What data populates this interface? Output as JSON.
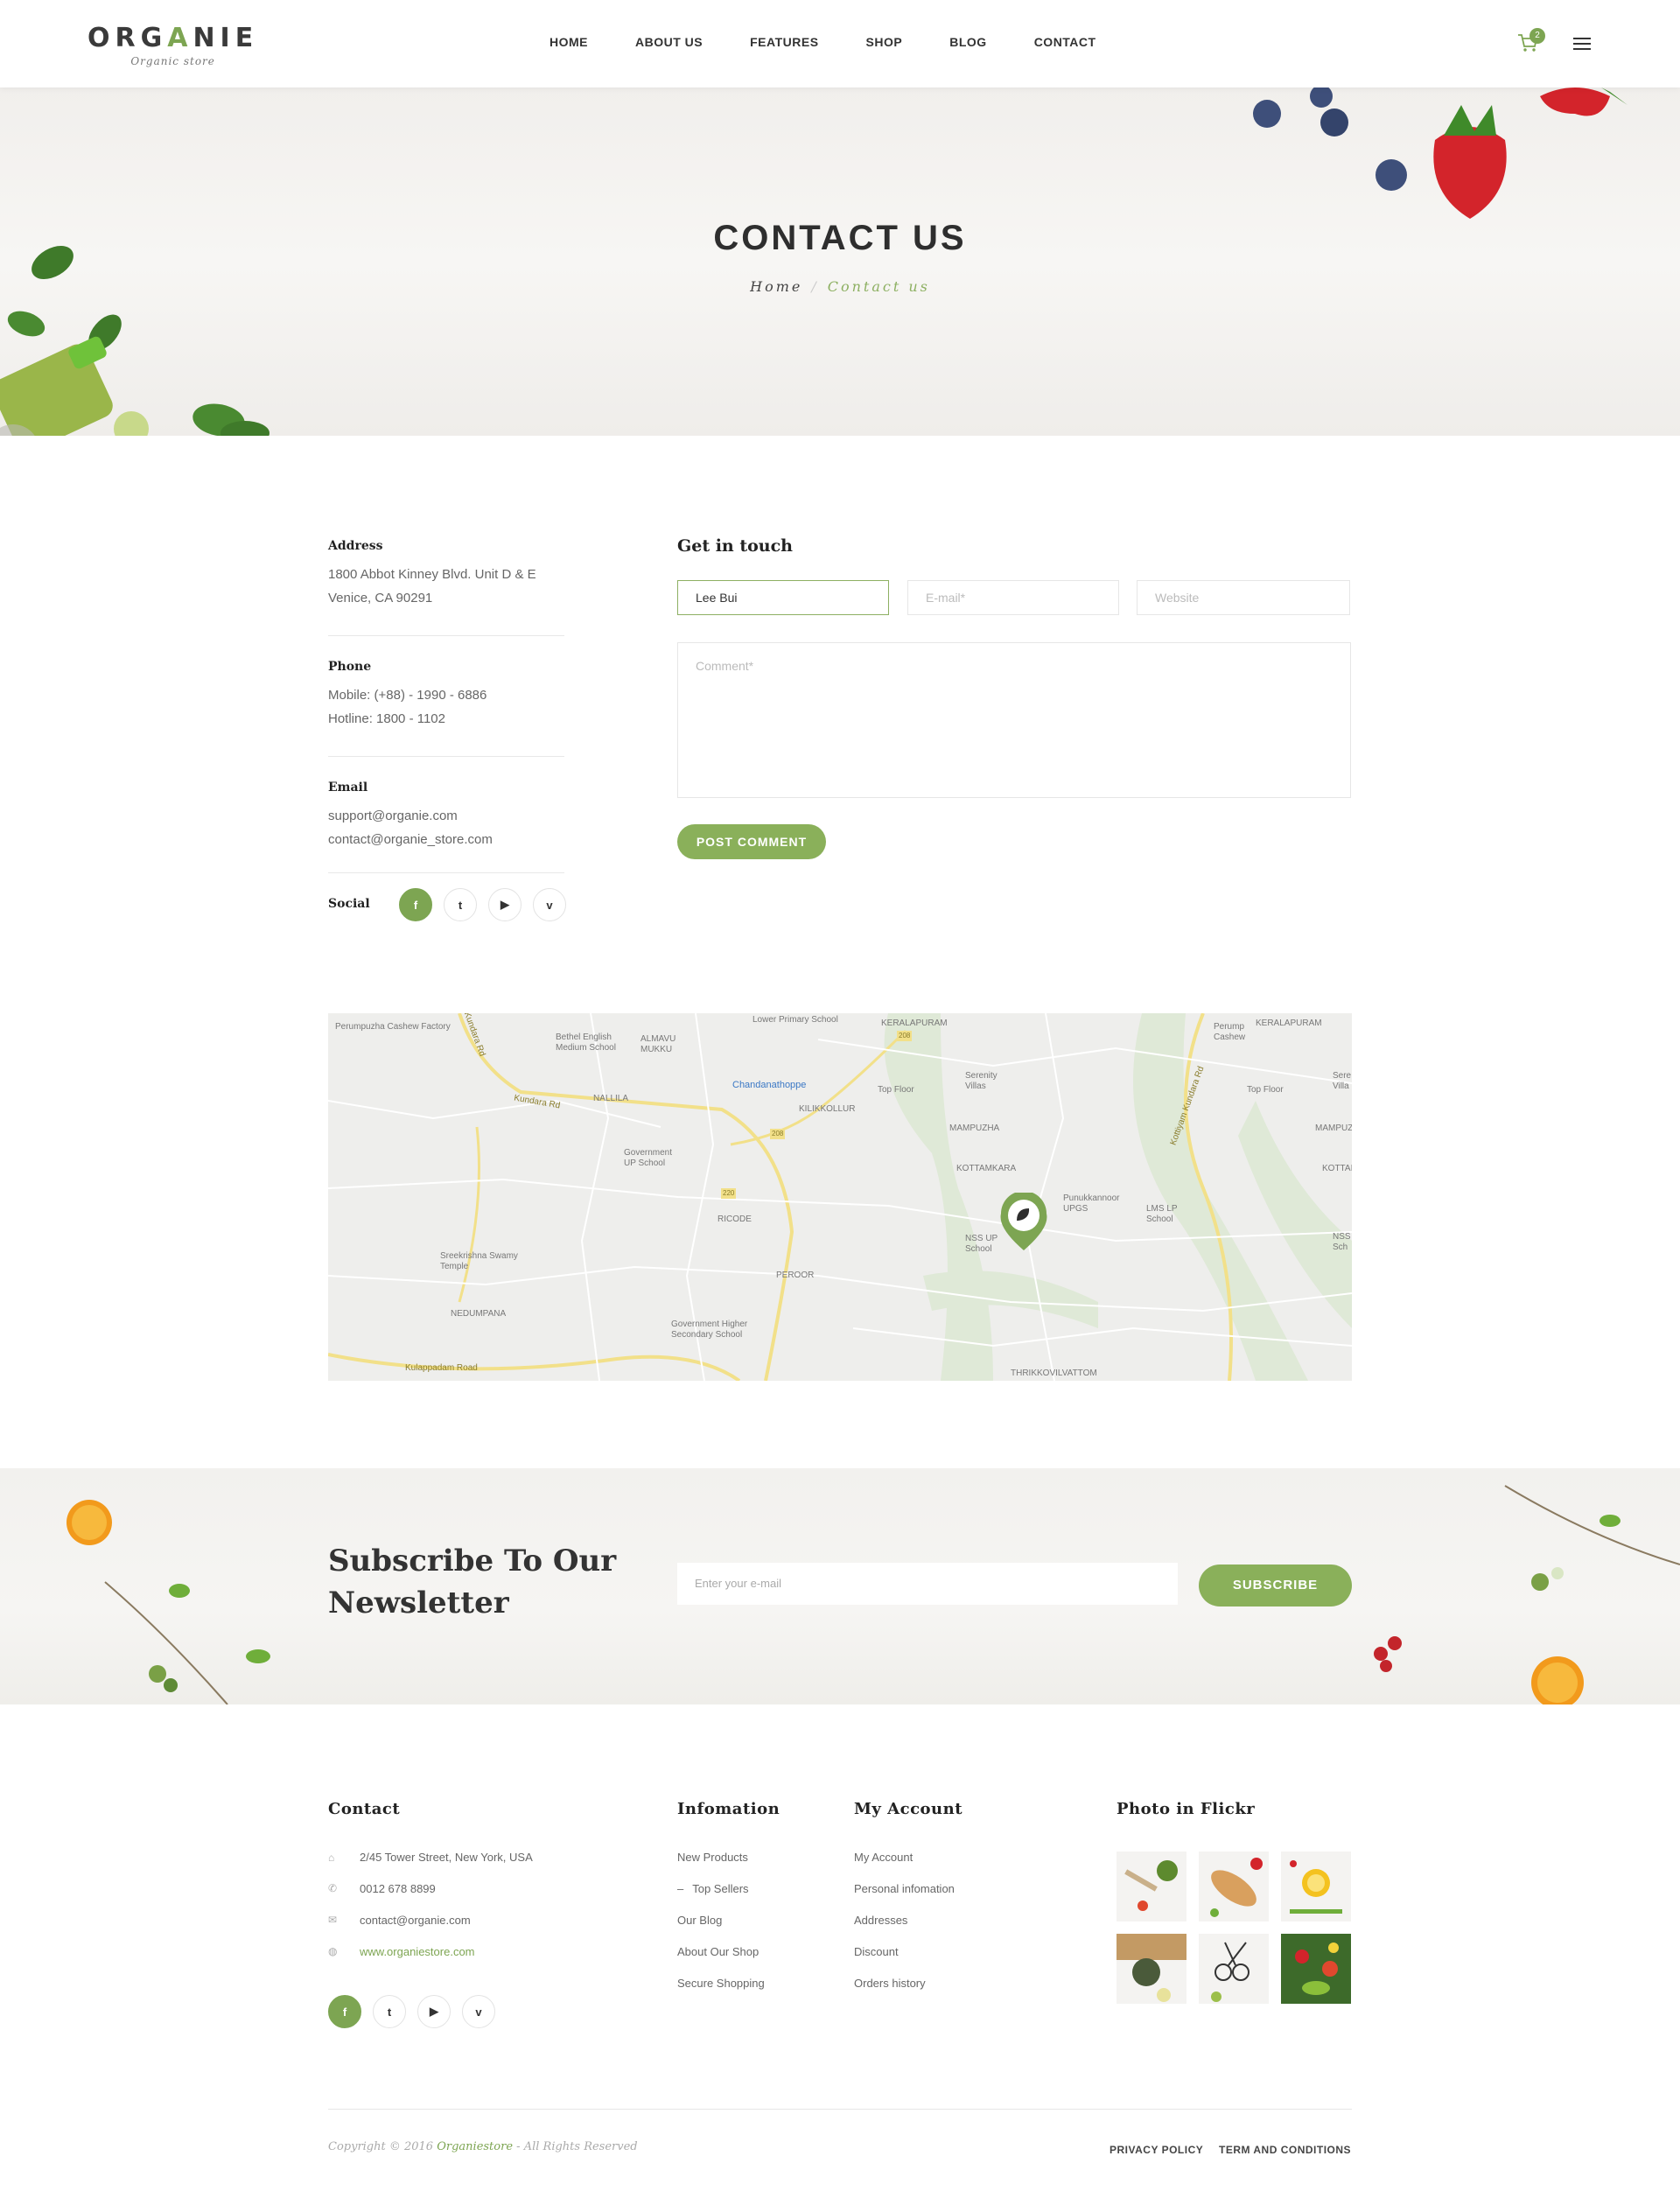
{
  "header": {
    "logo_text_a": "ORG",
    "logo_text_b": "A",
    "logo_text_c": "NIE",
    "logo_sub": "Organic store",
    "nav": [
      "HOME",
      "ABOUT US",
      "FEATURES",
      "SHOP",
      "BLOG",
      "CONTACT"
    ],
    "cart_count": "2",
    "cart_icon": "cart-icon",
    "menu_icon": "hamburger-menu-icon"
  },
  "hero": {
    "title": "CONTACT US",
    "breadcrumb_home": "Home",
    "breadcrumb_sep": "/",
    "breadcrumb_current": "Contact us"
  },
  "contact_info": {
    "address_label": "Address",
    "address_line1": "1800 Abbot Kinney Blvd. Unit D & E",
    "address_line2": "Venice, CA 90291",
    "phone_label": "Phone",
    "phone_mobile": "Mobile: (+88) - 1990 - 6886",
    "phone_hotline": "Hotline: 1800 - 1102",
    "email_label": "Email",
    "email_1": "support@organie.com",
    "email_2": "contact@organie_store.com",
    "social_label": "Social",
    "social_icons": [
      "f",
      "t",
      "▶",
      "v"
    ]
  },
  "form": {
    "title": "Get in touch",
    "name_value": "Lee Bui",
    "email_placeholder": "E-mail*",
    "website_placeholder": "Website",
    "comment_placeholder": "Comment*",
    "submit_label": "POST COMMENT"
  },
  "map": {
    "labels": [
      "Perumpuzha Cashew Factory",
      "Bethel English Medium School",
      "ALMAVU MUKKU",
      "Lower Primary School",
      "KERALAPURAM",
      "Perump Cashew",
      "KERALAPURAM",
      "Kundara Rd",
      "NALLILA",
      "Chandanathoppe",
      "Top Floor",
      "Serenity Villas",
      "KILIKKOLLUR",
      "Top Floor",
      "Sere Villa",
      "Government UP School",
      "MAMPUZHA",
      "MAMPUZ",
      "KOTTAMKARA",
      "KOTTAI",
      "Punukkannoor UPGS",
      "LMS LP School",
      "RICODE",
      "NSS UP School",
      "NSS Sch",
      "Sreekrishna Swamy Temple",
      "PEROOR",
      "NEDUMPANA",
      "Government Higher Secondary School",
      "Kulappadam Road",
      "THRIKKOVILVATTOM",
      "Kottiyam Kundara Rd",
      "Kundara Rd"
    ],
    "road_numbers": [
      "208",
      "208",
      "220"
    ],
    "marker_icon": "leaf-map-marker-icon"
  },
  "newsletter": {
    "title": "Subscribe To Our Newsletter",
    "input_placeholder": "Enter your e-mail",
    "button_label": "SUBSCRIBE"
  },
  "footer": {
    "contact_title": "Contact",
    "contact_address": "2/45 Tower Street, New York, USA",
    "contact_phone": "0012 678 8899",
    "contact_email": "contact@organie.com",
    "contact_web": "www.organiestore.com",
    "info_title": "Infomation",
    "info_items": [
      "New Products",
      "Top Sellers",
      "Our Blog",
      "About Our Shop",
      "Secure Shopping"
    ],
    "account_title": "My Account",
    "account_items": [
      "My Account",
      "Personal infomation",
      "Addresses",
      "Discount",
      "Orders history"
    ],
    "flickr_title": "Photo in Flickr",
    "copyright_a": "Copyright © 2016 ",
    "copyright_brand": "Organiestore",
    "copyright_b": " - All Rights Reserved",
    "privacy": "PRIVACY POLICY",
    "terms": "TERM AND CONDITIONS"
  },
  "colors": {
    "accent": "#8ab05a",
    "text_dark": "#222222",
    "text_body": "#666666"
  }
}
